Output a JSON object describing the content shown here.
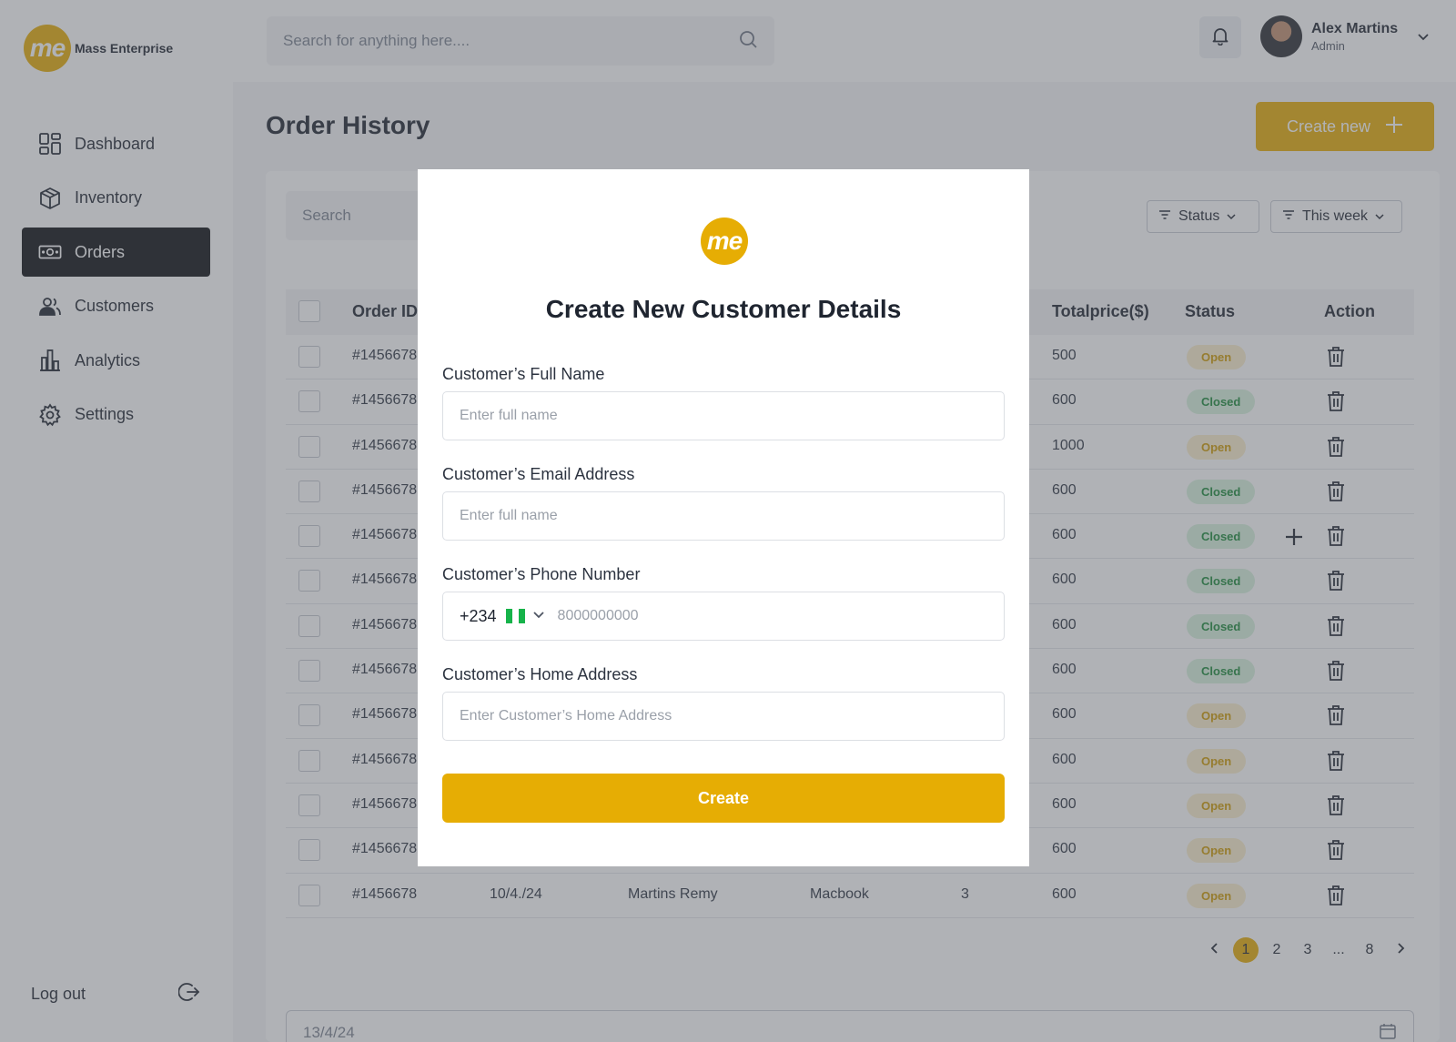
{
  "brand": {
    "logo_text": "me",
    "name": "Mass Enterprise"
  },
  "topbar": {
    "search_placeholder": "Search for anything here....",
    "user": {
      "name": "Alex Martins",
      "role": "Admin"
    }
  },
  "sidebar": {
    "items": [
      {
        "label": "Dashboard",
        "icon": "dashboard-icon",
        "active": false
      },
      {
        "label": "Inventory",
        "icon": "box-icon",
        "active": false
      },
      {
        "label": "Orders",
        "icon": "cash-icon",
        "active": true
      },
      {
        "label": "Customers",
        "icon": "users-icon",
        "active": false
      },
      {
        "label": "Analytics",
        "icon": "bar-chart-icon",
        "active": false
      },
      {
        "label": "Settings",
        "icon": "gear-icon",
        "active": false
      }
    ],
    "logout_label": "Log out"
  },
  "page": {
    "title": "Order History",
    "create_new_label": "Create new",
    "table_search_placeholder": "Search",
    "filters": {
      "status": "Status",
      "period": "This week"
    },
    "columns": {
      "order_id": "Order ID",
      "total": "Totalprice($)",
      "status": "Status",
      "action": "Action"
    },
    "rows": [
      {
        "id": "#1456678",
        "total": "500",
        "status": "Open"
      },
      {
        "id": "#1456678",
        "total": "600",
        "status": "Closed"
      },
      {
        "id": "#1456678",
        "total": "1000",
        "status": "Open"
      },
      {
        "id": "#1456678",
        "total": "600",
        "status": "Closed"
      },
      {
        "id": "#1456678",
        "total": "600",
        "status": "Closed"
      },
      {
        "id": "#1456678",
        "total": "600",
        "status": "Closed"
      },
      {
        "id": "#1456678",
        "total": "600",
        "status": "Closed"
      },
      {
        "id": "#1456678",
        "total": "600",
        "status": "Closed"
      },
      {
        "id": "#1456678",
        "total": "600",
        "status": "Open"
      },
      {
        "id": "#1456678",
        "total": "600",
        "status": "Open"
      },
      {
        "id": "#1456678",
        "total": "600",
        "status": "Open"
      },
      {
        "id": "#1456678",
        "total": "600",
        "status": "Open"
      },
      {
        "id": "#1456678",
        "date": "10/4./24",
        "customer": "Martins Remy",
        "product": "Macbook",
        "qty": "3",
        "total": "600",
        "status": "Open"
      }
    ],
    "pagination": {
      "pages": [
        "1",
        "2",
        "3",
        "...",
        "8"
      ],
      "current": "1"
    },
    "date_value": "13/4/24"
  },
  "modal": {
    "logo_text": "me",
    "title": "Create New Customer Details",
    "full_name": {
      "label": "Customer’s Full Name",
      "placeholder": "Enter full name"
    },
    "email": {
      "label": "Customer’s Email Address",
      "placeholder": "Enter full name"
    },
    "phone": {
      "label": "Customer’s Phone Number",
      "code": "+234",
      "placeholder": "8000000000"
    },
    "address": {
      "label": "Customer’s Home Address",
      "placeholder": "Enter Customer’s Home Address"
    },
    "submit_label": "Create"
  },
  "colors": {
    "accent": "#e6ad04",
    "open_badge_bg": "#fbefcc",
    "closed_badge_bg": "#d7f1dd",
    "nav_active": "#0d0f12"
  }
}
